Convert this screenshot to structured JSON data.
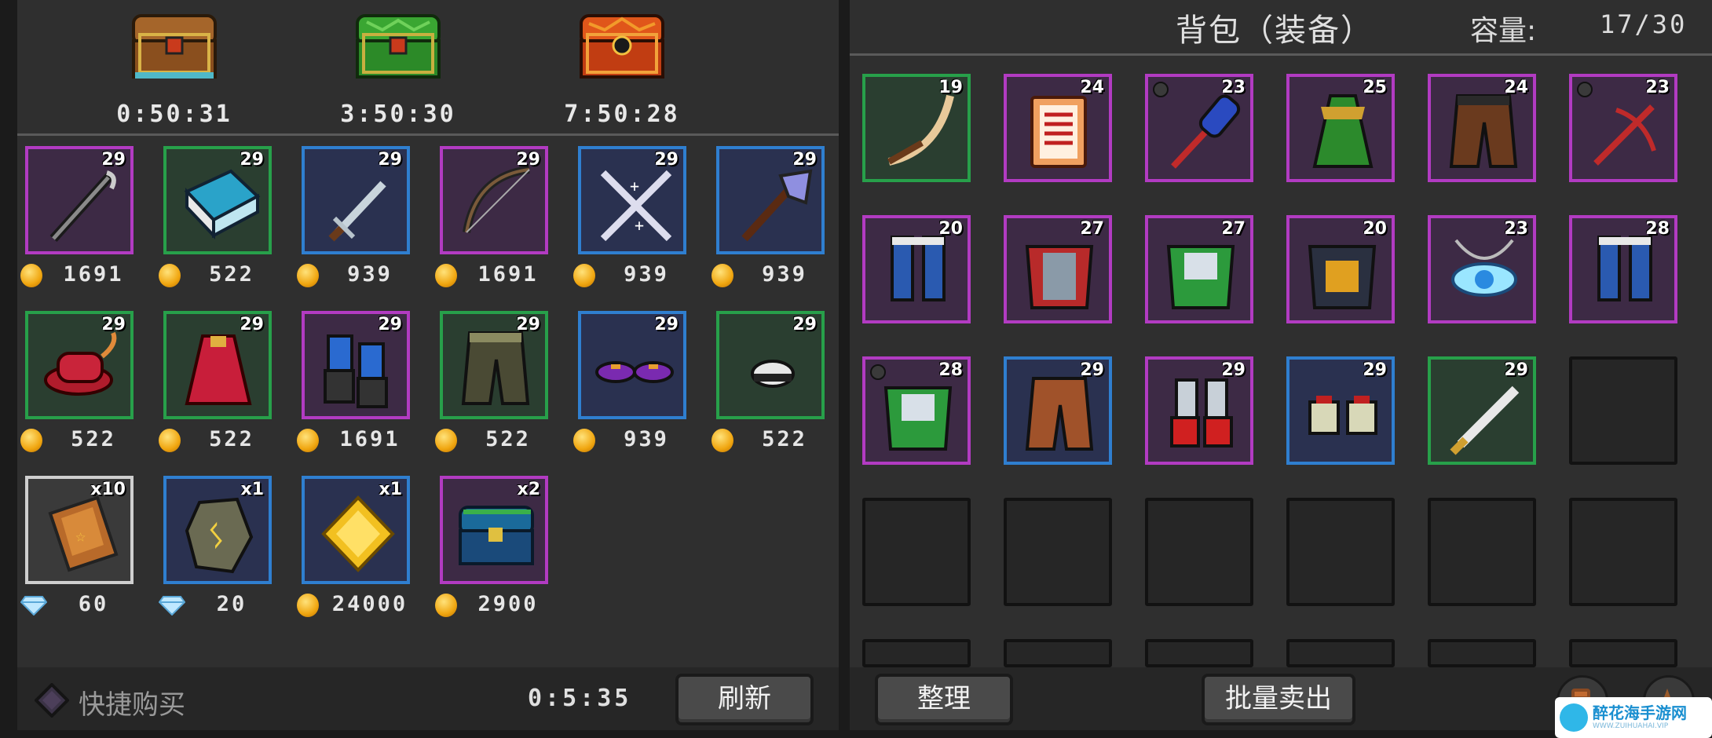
{
  "chests": [
    {
      "icon": "wooden-chest-icon",
      "timer": "0:50:31"
    },
    {
      "icon": "green-chest-icon",
      "timer": "3:50:30"
    },
    {
      "icon": "red-chest-icon",
      "timer": "7:50:28"
    }
  ],
  "shop": {
    "rows": [
      [
        {
          "icon": "staff-icon",
          "rarity": "purple",
          "level": "29",
          "currency": "coin",
          "price": "1691"
        },
        {
          "icon": "book-icon",
          "rarity": "green",
          "level": "29",
          "currency": "coin",
          "price": "522"
        },
        {
          "icon": "dagger-icon",
          "rarity": "blue",
          "level": "29",
          "currency": "coin",
          "price": "939"
        },
        {
          "icon": "bow-icon",
          "rarity": "purple",
          "level": "29",
          "currency": "coin",
          "price": "1691"
        },
        {
          "icon": "crossed-swords-icon",
          "rarity": "blue",
          "level": "29",
          "currency": "coin",
          "price": "939"
        },
        {
          "icon": "axe-icon",
          "rarity": "blue",
          "level": "29",
          "currency": "coin",
          "price": "939"
        }
      ],
      [
        {
          "icon": "hat-icon",
          "rarity": "green",
          "level": "29",
          "currency": "coin",
          "price": "522"
        },
        {
          "icon": "robe-icon",
          "rarity": "green",
          "level": "29",
          "currency": "coin",
          "price": "522"
        },
        {
          "icon": "gauntlets-icon",
          "rarity": "purple",
          "level": "29",
          "currency": "coin",
          "price": "1691"
        },
        {
          "icon": "pants-icon",
          "rarity": "green",
          "level": "29",
          "currency": "coin",
          "price": "522"
        },
        {
          "icon": "shoes-icon",
          "rarity": "blue",
          "level": "29",
          "currency": "coin",
          "price": "939"
        },
        {
          "icon": "helmet-icon",
          "rarity": "green",
          "level": "29",
          "currency": "coin",
          "price": "522"
        }
      ],
      [
        {
          "icon": "spellbook-icon",
          "rarity": "white",
          "level": "x10",
          "currency": "diamond",
          "price": "60"
        },
        {
          "icon": "rune-stone-icon",
          "rarity": "blue",
          "level": "x1",
          "currency": "diamond",
          "price": "20"
        },
        {
          "icon": "gold-crystal-icon",
          "rarity": "blue",
          "level": "x1",
          "currency": "coin",
          "price": "24000"
        },
        {
          "icon": "blue-chest-icon",
          "rarity": "purple",
          "level": "x2",
          "currency": "coin",
          "price": "2900"
        }
      ]
    ],
    "quick_buy_label": "快捷购买",
    "refresh_timer": "0:5:35",
    "refresh_label": "刷新"
  },
  "bag": {
    "title": "背包（装备）",
    "capacity_label": "容量:",
    "capacity_value": "17/30",
    "rows": [
      [
        {
          "icon": "scythe-blade-icon",
          "rarity": "green",
          "level": "19",
          "dot": false
        },
        {
          "icon": "scroll-icon",
          "rarity": "purple",
          "level": "24",
          "dot": false
        },
        {
          "icon": "mace-icon",
          "rarity": "purple",
          "level": "23",
          "dot": true
        },
        {
          "icon": "green-robe-icon",
          "rarity": "purple",
          "level": "25",
          "dot": false
        },
        {
          "icon": "brown-pants-icon",
          "rarity": "purple",
          "level": "24",
          "dot": false
        },
        {
          "icon": "crossbow-icon",
          "rarity": "purple",
          "level": "23",
          "dot": true
        }
      ],
      [
        {
          "icon": "blue-greaves-icon",
          "rarity": "purple",
          "level": "20",
          "dot": false
        },
        {
          "icon": "red-armor-icon",
          "rarity": "purple",
          "level": "27",
          "dot": false
        },
        {
          "icon": "green-armor-icon",
          "rarity": "purple",
          "level": "27",
          "dot": false
        },
        {
          "icon": "gold-armor-icon",
          "rarity": "purple",
          "level": "20",
          "dot": false
        },
        {
          "icon": "amulet-icon",
          "rarity": "purple",
          "level": "23",
          "dot": false
        },
        {
          "icon": "blue-greaves-icon",
          "rarity": "purple",
          "level": "28",
          "dot": false
        }
      ],
      [
        {
          "icon": "green-armor-icon",
          "rarity": "purple",
          "level": "28",
          "dot": true
        },
        {
          "icon": "leather-pants-icon",
          "rarity": "blue",
          "level": "29",
          "dot": false
        },
        {
          "icon": "red-gauntlets-icon",
          "rarity": "purple",
          "level": "29",
          "dot": false
        },
        {
          "icon": "boots-icon",
          "rarity": "blue",
          "level": "29",
          "dot": false
        },
        {
          "icon": "knife-icon",
          "rarity": "green",
          "level": "29",
          "dot": false
        },
        {
          "icon": "",
          "rarity": "empty",
          "level": "",
          "dot": false
        }
      ]
    ],
    "sort_label": "整理",
    "bulk_sell_label": "批量卖出"
  },
  "watermark": {
    "main": "醉花海手游网",
    "sub": "WWW.ZUIHUAHAI.VIP"
  }
}
